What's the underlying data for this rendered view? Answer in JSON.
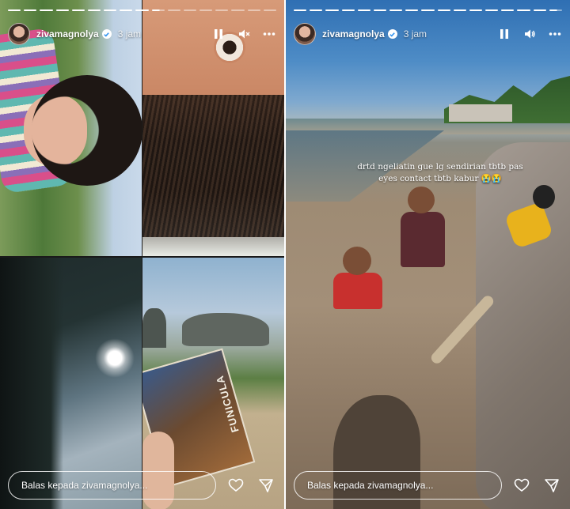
{
  "stories": [
    {
      "username": "zivamagnolya",
      "time": "3 jam",
      "reply_placeholder": "Balas kepada zivamagnolya...",
      "progress_total": 17,
      "progress_done": 9,
      "muted": true,
      "book_cover_text": "FUNICULA"
    },
    {
      "username": "zivamagnolya",
      "time": "3 jam",
      "reply_placeholder": "Balas kepada zivamagnolya...",
      "progress_total": 17,
      "progress_done": 16,
      "muted": false,
      "caption_line1": "drtd ngeliatin gue lg sendirian tbtb pas",
      "caption_line2": "eyes contact tbtb kabur 😭😭"
    }
  ],
  "icons": {
    "verified": "verified-badge-icon",
    "pause": "pause-icon",
    "sound": "sound-icon",
    "more": "more-icon",
    "like": "heart-icon",
    "share": "send-icon"
  },
  "colors": {
    "accent": "#ffffff",
    "verified": "#3897f0"
  }
}
